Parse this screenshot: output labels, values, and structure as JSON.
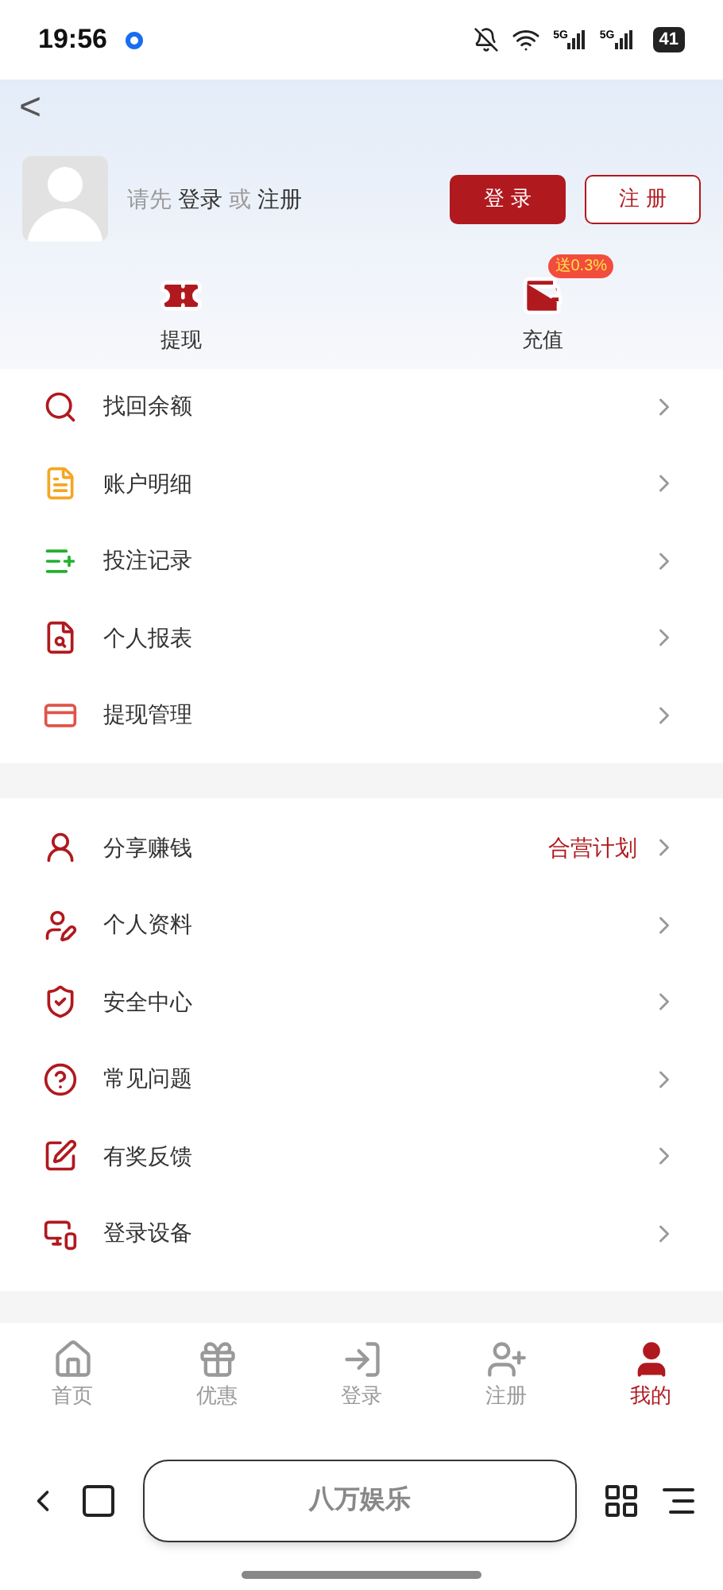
{
  "status_bar": {
    "time": "19:56",
    "network_labels": [
      "5G",
      "5G"
    ],
    "battery": "41"
  },
  "header": {
    "back": "<",
    "prompt": [
      {
        "text": "请先",
        "strong": false
      },
      {
        "text": "登录",
        "strong": true
      },
      {
        "text": "或",
        "strong": false
      },
      {
        "text": "注册",
        "strong": true
      }
    ],
    "buttons": [
      {
        "label": "登 录",
        "kind": "primary"
      },
      {
        "label": "注 册",
        "kind": "outline"
      }
    ]
  },
  "quick_actions": [
    {
      "label": "提现"
    },
    {
      "label": "充值",
      "badge": "送0.3%"
    }
  ],
  "menu_sections": [
    {
      "items": [
        {
          "label": "找回余额",
          "color": "#b0191e"
        },
        {
          "label": "账户明细",
          "color": "#f5a623"
        },
        {
          "label": "投注记录",
          "color": "#22b02e"
        },
        {
          "label": "个人报表",
          "color": "#b0191e"
        },
        {
          "label": "提现管理",
          "color": "#e0544a"
        }
      ]
    },
    {
      "items": [
        {
          "label": "分享赚钱",
          "color": "#b0191e",
          "note": "合营计划"
        },
        {
          "label": "个人资料",
          "color": "#b0191e"
        },
        {
          "label": "安全中心",
          "color": "#b0191e"
        },
        {
          "label": "常见问题",
          "color": "#b0191e"
        },
        {
          "label": "有奖反馈",
          "color": "#b0191e"
        },
        {
          "label": "登录设备",
          "color": "#b0191e"
        }
      ]
    }
  ],
  "tab_bar": [
    {
      "label": "首页",
      "selected": false
    },
    {
      "label": "优惠",
      "selected": false
    },
    {
      "label": "登录",
      "selected": false
    },
    {
      "label": "注册",
      "selected": false
    },
    {
      "label": "我的",
      "selected": true
    }
  ],
  "browser_bar": {
    "title": "八万娱乐"
  }
}
